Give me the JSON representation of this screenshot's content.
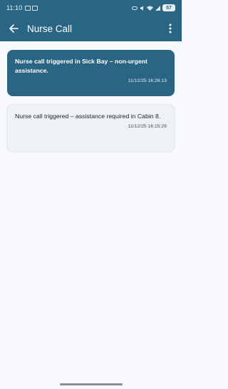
{
  "status_bar": {
    "time": "11:10",
    "battery": "57"
  },
  "app_bar": {
    "title": "Nurse Call",
    "back_icon": "arrow-left-icon",
    "menu_icon": "more-vertical-icon"
  },
  "notifications": [
    {
      "message": "Nurse call triggered in Sick Bay – non-urgent assistance.",
      "timestamp": "11/12/25 16:26:13",
      "highlighted": true
    },
    {
      "message": "Nurse call triggered – assistance required in Cabin 8.",
      "timestamp": "11/12/25 16:15:29",
      "highlighted": false
    }
  ],
  "colors": {
    "primary": "#2a6584",
    "background": "#f8f9fd",
    "card_secondary": "#eef1f6"
  }
}
